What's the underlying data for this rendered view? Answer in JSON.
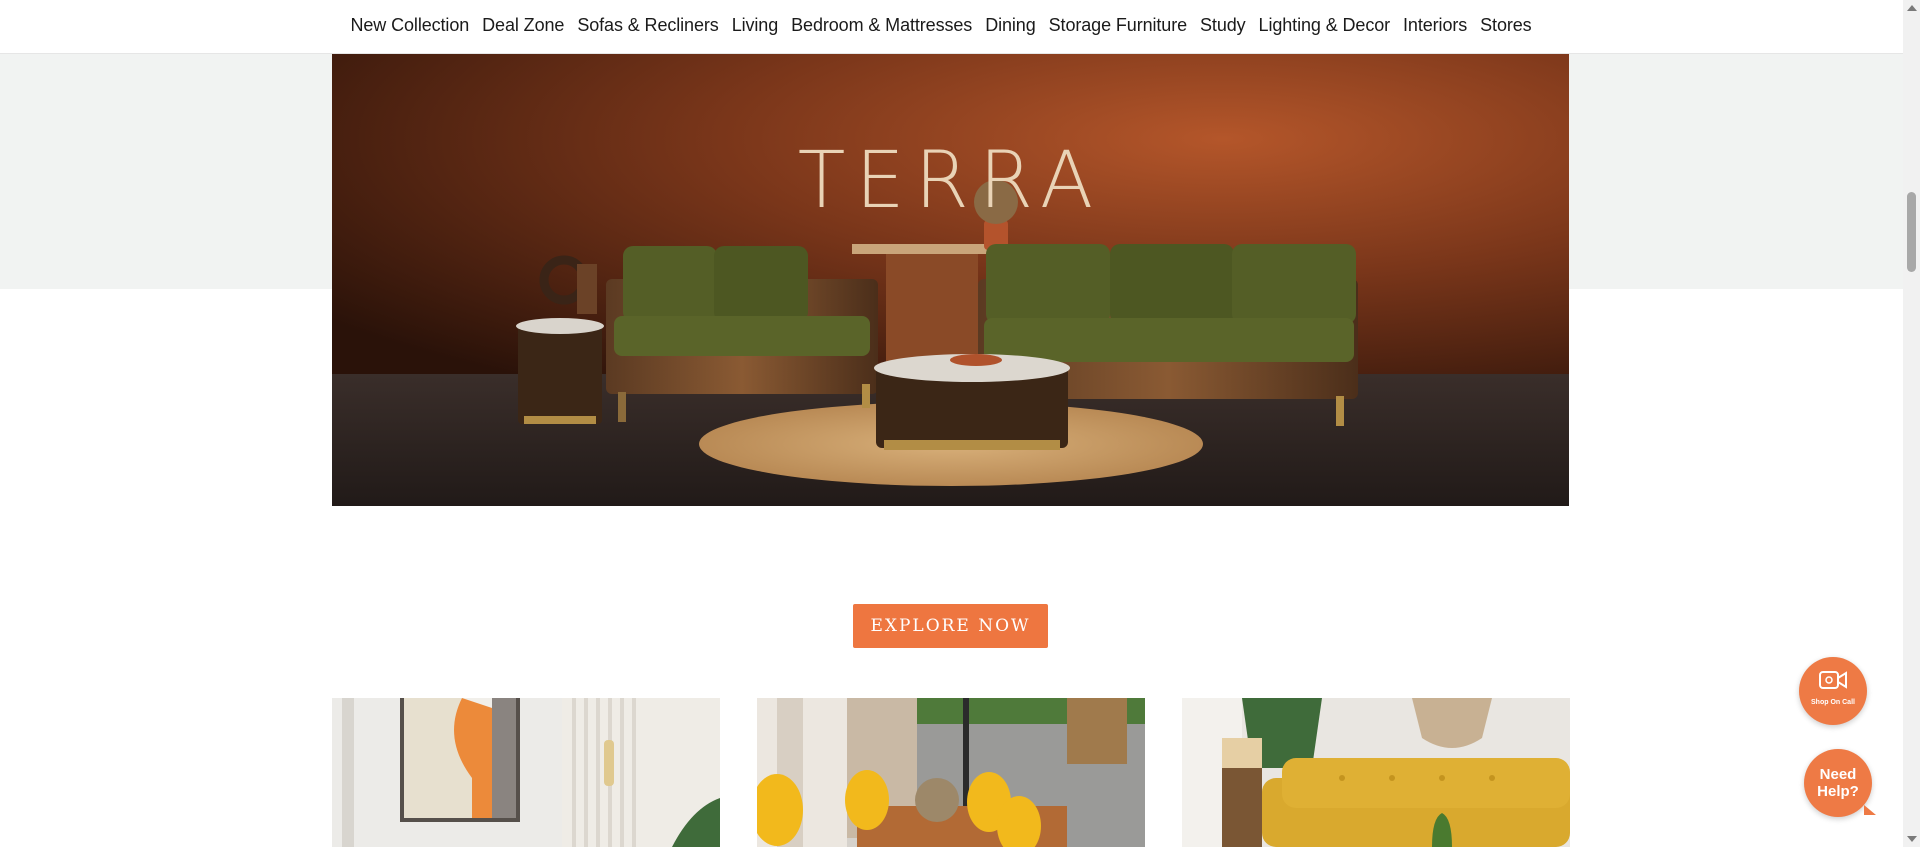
{
  "nav": {
    "items": [
      {
        "label": "New Collection"
      },
      {
        "label": "Deal Zone"
      },
      {
        "label": "Sofas & Recliners"
      },
      {
        "label": "Living"
      },
      {
        "label": "Bedroom & Mattresses"
      },
      {
        "label": "Dining"
      },
      {
        "label": "Storage Furniture"
      },
      {
        "label": "Study"
      },
      {
        "label": "Lighting & Decor"
      },
      {
        "label": "Interiors"
      },
      {
        "label": "Stores"
      }
    ]
  },
  "hero": {
    "brand_logo": "TERRA"
  },
  "cta": {
    "explore_label": "EXPLORE NOW"
  },
  "floating": {
    "shop_on_call_label": "Shop On Call",
    "need_help_label": "Need Help?"
  },
  "colors": {
    "accent": "#ee7640",
    "hero_wall": "#7a3a1c",
    "sofa_green": "#545e26",
    "band_gray": "#f1f3f2"
  }
}
